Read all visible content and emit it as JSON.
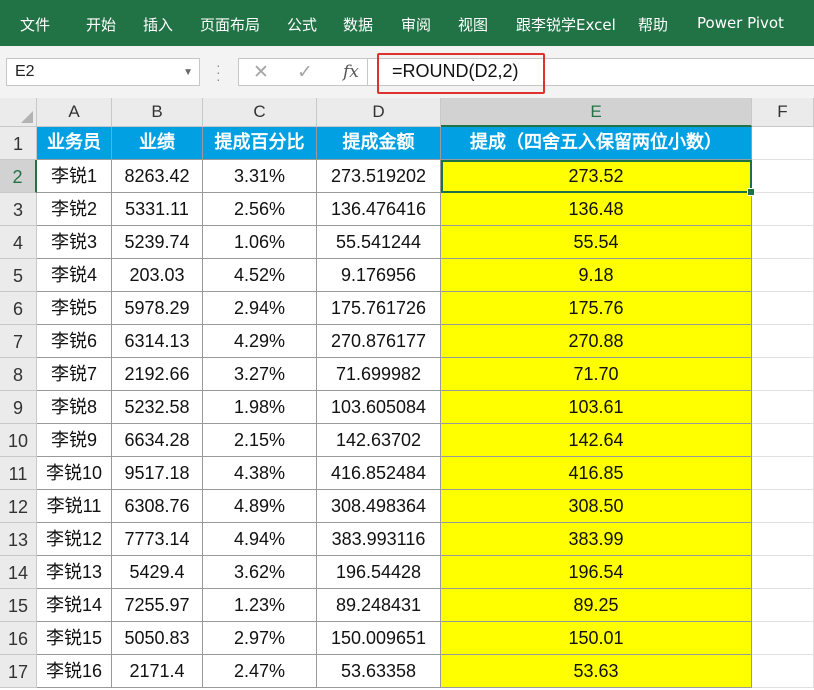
{
  "ribbon": {
    "tabs": [
      "文件",
      "开始",
      "插入",
      "页面布局",
      "公式",
      "数据",
      "审阅",
      "视图",
      "跟李锐学Excel",
      "帮助",
      "Power Pivot"
    ]
  },
  "formula_bar": {
    "name_box": "E2",
    "fx_label": "fx",
    "formula": "=ROUND(D2,2)"
  },
  "sheet": {
    "columns": [
      "A",
      "B",
      "C",
      "D",
      "E",
      "F"
    ],
    "row_numbers": [
      "1",
      "2",
      "3",
      "4",
      "5",
      "6",
      "7",
      "8",
      "9",
      "10",
      "11",
      "12",
      "13",
      "14",
      "15",
      "16",
      "17"
    ],
    "header": [
      "业务员",
      "业绩",
      "提成百分比",
      "提成金额",
      "提成（四舍五入保留两位小数）"
    ],
    "rows": [
      [
        "李锐1",
        "8263.42",
        "3.31%",
        "273.519202",
        "273.52"
      ],
      [
        "李锐2",
        "5331.11",
        "2.56%",
        "136.476416",
        "136.48"
      ],
      [
        "李锐3",
        "5239.74",
        "1.06%",
        "55.541244",
        "55.54"
      ],
      [
        "李锐4",
        "203.03",
        "4.52%",
        "9.176956",
        "9.18"
      ],
      [
        "李锐5",
        "5978.29",
        "2.94%",
        "175.761726",
        "175.76"
      ],
      [
        "李锐6",
        "6314.13",
        "4.29%",
        "270.876177",
        "270.88"
      ],
      [
        "李锐7",
        "2192.66",
        "3.27%",
        "71.699982",
        "71.70"
      ],
      [
        "李锐8",
        "5232.58",
        "1.98%",
        "103.605084",
        "103.61"
      ],
      [
        "李锐9",
        "6634.28",
        "2.15%",
        "142.63702",
        "142.64"
      ],
      [
        "李锐10",
        "9517.18",
        "4.38%",
        "416.852484",
        "416.85"
      ],
      [
        "李锐11",
        "6308.76",
        "4.89%",
        "308.498364",
        "308.50"
      ],
      [
        "李锐12",
        "7773.14",
        "4.94%",
        "383.993116",
        "383.99"
      ],
      [
        "李锐13",
        "5429.4",
        "3.62%",
        "196.54428",
        "196.54"
      ],
      [
        "李锐14",
        "7255.97",
        "1.23%",
        "89.248431",
        "89.25"
      ],
      [
        "李锐15",
        "5050.83",
        "2.97%",
        "150.009651",
        "150.01"
      ],
      [
        "李锐16",
        "2171.4",
        "2.47%",
        "53.63358",
        "53.63"
      ]
    ]
  },
  "colors": {
    "ribbon": "#217346",
    "header_fill": "#00a0e3",
    "result_fill": "#ffff00",
    "highlight_box": "#e0322d"
  }
}
